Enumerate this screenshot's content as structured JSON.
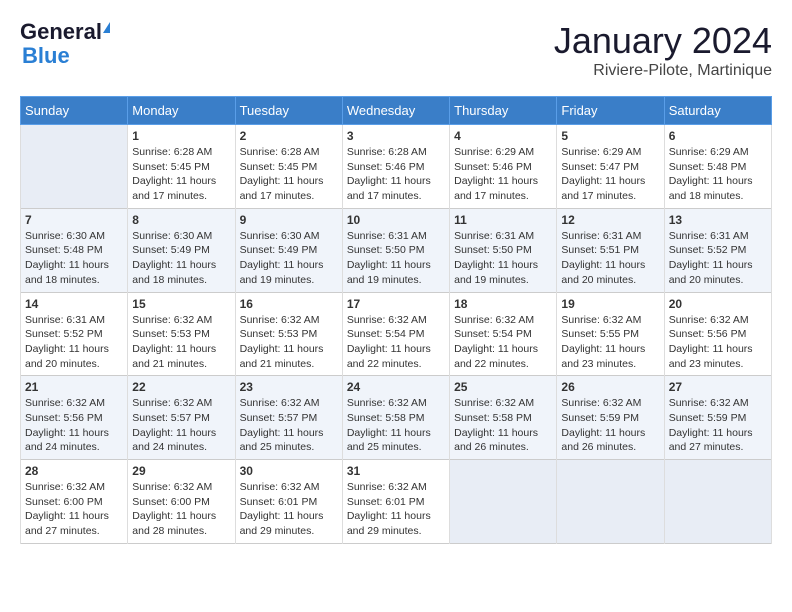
{
  "header": {
    "logo_line1": "General",
    "logo_line2": "Blue",
    "month": "January 2024",
    "location": "Riviere-Pilote, Martinique"
  },
  "days_of_week": [
    "Sunday",
    "Monday",
    "Tuesday",
    "Wednesday",
    "Thursday",
    "Friday",
    "Saturday"
  ],
  "weeks": [
    [
      {
        "day": "",
        "info": ""
      },
      {
        "day": "1",
        "info": "Sunrise: 6:28 AM\nSunset: 5:45 PM\nDaylight: 11 hours\nand 17 minutes."
      },
      {
        "day": "2",
        "info": "Sunrise: 6:28 AM\nSunset: 5:45 PM\nDaylight: 11 hours\nand 17 minutes."
      },
      {
        "day": "3",
        "info": "Sunrise: 6:28 AM\nSunset: 5:46 PM\nDaylight: 11 hours\nand 17 minutes."
      },
      {
        "day": "4",
        "info": "Sunrise: 6:29 AM\nSunset: 5:46 PM\nDaylight: 11 hours\nand 17 minutes."
      },
      {
        "day": "5",
        "info": "Sunrise: 6:29 AM\nSunset: 5:47 PM\nDaylight: 11 hours\nand 17 minutes."
      },
      {
        "day": "6",
        "info": "Sunrise: 6:29 AM\nSunset: 5:48 PM\nDaylight: 11 hours\nand 18 minutes."
      }
    ],
    [
      {
        "day": "7",
        "info": "Sunrise: 6:30 AM\nSunset: 5:48 PM\nDaylight: 11 hours\nand 18 minutes."
      },
      {
        "day": "8",
        "info": "Sunrise: 6:30 AM\nSunset: 5:49 PM\nDaylight: 11 hours\nand 18 minutes."
      },
      {
        "day": "9",
        "info": "Sunrise: 6:30 AM\nSunset: 5:49 PM\nDaylight: 11 hours\nand 19 minutes."
      },
      {
        "day": "10",
        "info": "Sunrise: 6:31 AM\nSunset: 5:50 PM\nDaylight: 11 hours\nand 19 minutes."
      },
      {
        "day": "11",
        "info": "Sunrise: 6:31 AM\nSunset: 5:50 PM\nDaylight: 11 hours\nand 19 minutes."
      },
      {
        "day": "12",
        "info": "Sunrise: 6:31 AM\nSunset: 5:51 PM\nDaylight: 11 hours\nand 20 minutes."
      },
      {
        "day": "13",
        "info": "Sunrise: 6:31 AM\nSunset: 5:52 PM\nDaylight: 11 hours\nand 20 minutes."
      }
    ],
    [
      {
        "day": "14",
        "info": "Sunrise: 6:31 AM\nSunset: 5:52 PM\nDaylight: 11 hours\nand 20 minutes."
      },
      {
        "day": "15",
        "info": "Sunrise: 6:32 AM\nSunset: 5:53 PM\nDaylight: 11 hours\nand 21 minutes."
      },
      {
        "day": "16",
        "info": "Sunrise: 6:32 AM\nSunset: 5:53 PM\nDaylight: 11 hours\nand 21 minutes."
      },
      {
        "day": "17",
        "info": "Sunrise: 6:32 AM\nSunset: 5:54 PM\nDaylight: 11 hours\nand 22 minutes."
      },
      {
        "day": "18",
        "info": "Sunrise: 6:32 AM\nSunset: 5:54 PM\nDaylight: 11 hours\nand 22 minutes."
      },
      {
        "day": "19",
        "info": "Sunrise: 6:32 AM\nSunset: 5:55 PM\nDaylight: 11 hours\nand 23 minutes."
      },
      {
        "day": "20",
        "info": "Sunrise: 6:32 AM\nSunset: 5:56 PM\nDaylight: 11 hours\nand 23 minutes."
      }
    ],
    [
      {
        "day": "21",
        "info": "Sunrise: 6:32 AM\nSunset: 5:56 PM\nDaylight: 11 hours\nand 24 minutes."
      },
      {
        "day": "22",
        "info": "Sunrise: 6:32 AM\nSunset: 5:57 PM\nDaylight: 11 hours\nand 24 minutes."
      },
      {
        "day": "23",
        "info": "Sunrise: 6:32 AM\nSunset: 5:57 PM\nDaylight: 11 hours\nand 25 minutes."
      },
      {
        "day": "24",
        "info": "Sunrise: 6:32 AM\nSunset: 5:58 PM\nDaylight: 11 hours\nand 25 minutes."
      },
      {
        "day": "25",
        "info": "Sunrise: 6:32 AM\nSunset: 5:58 PM\nDaylight: 11 hours\nand 26 minutes."
      },
      {
        "day": "26",
        "info": "Sunrise: 6:32 AM\nSunset: 5:59 PM\nDaylight: 11 hours\nand 26 minutes."
      },
      {
        "day": "27",
        "info": "Sunrise: 6:32 AM\nSunset: 5:59 PM\nDaylight: 11 hours\nand 27 minutes."
      }
    ],
    [
      {
        "day": "28",
        "info": "Sunrise: 6:32 AM\nSunset: 6:00 PM\nDaylight: 11 hours\nand 27 minutes."
      },
      {
        "day": "29",
        "info": "Sunrise: 6:32 AM\nSunset: 6:00 PM\nDaylight: 11 hours\nand 28 minutes."
      },
      {
        "day": "30",
        "info": "Sunrise: 6:32 AM\nSunset: 6:01 PM\nDaylight: 11 hours\nand 29 minutes."
      },
      {
        "day": "31",
        "info": "Sunrise: 6:32 AM\nSunset: 6:01 PM\nDaylight: 11 hours\nand 29 minutes."
      },
      {
        "day": "",
        "info": ""
      },
      {
        "day": "",
        "info": ""
      },
      {
        "day": "",
        "info": ""
      }
    ]
  ]
}
